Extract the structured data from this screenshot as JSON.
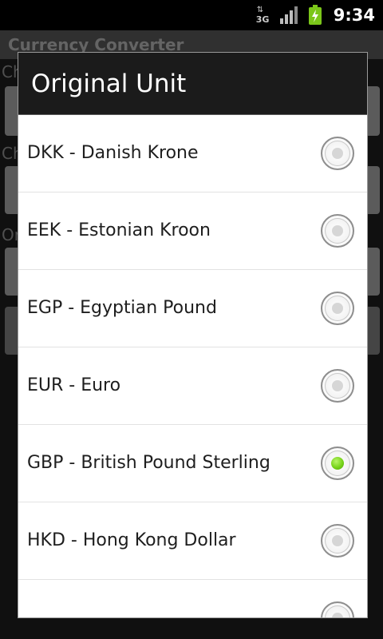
{
  "status_bar": {
    "network": "3G",
    "time": "9:34"
  },
  "app": {
    "title": "Currency Converter"
  },
  "dialog": {
    "title": "Original Unit",
    "options": [
      {
        "label": "DKK - Danish Krone",
        "checked": false
      },
      {
        "label": "EEK - Estonian Kroon",
        "checked": false
      },
      {
        "label": "EGP - Egyptian Pound",
        "checked": false
      },
      {
        "label": "EUR - Euro",
        "checked": false
      },
      {
        "label": "GBP - British Pound Sterling",
        "checked": true
      },
      {
        "label": "HKD - Hong Kong Dollar",
        "checked": false
      },
      {
        "label": "",
        "checked": false
      }
    ]
  },
  "colors": {
    "selected_radio": "#77d31a",
    "dialog_header": "#1b1b1b"
  }
}
